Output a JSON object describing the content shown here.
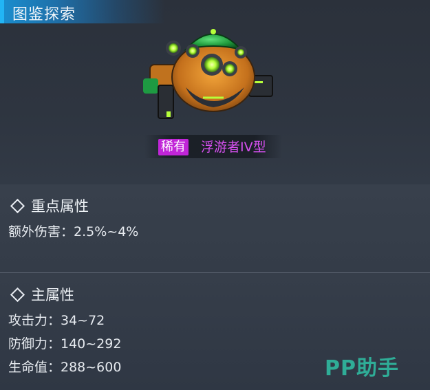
{
  "header": {
    "title": "图鉴探索"
  },
  "item": {
    "rarity": "稀有",
    "name": "浮游者IV型",
    "rarity_color": "#c125d8",
    "name_color": "#d650f0",
    "image_icon": "floating-robot-drone"
  },
  "key_attributes": {
    "heading": "重点属性",
    "stats": [
      "额外伤害：2.5%~4%"
    ]
  },
  "main_attributes": {
    "heading": "主属性",
    "stats": [
      "攻击力：34~72",
      "防御力：140~292",
      "生命值：288~600"
    ]
  },
  "watermark": "PP助手"
}
